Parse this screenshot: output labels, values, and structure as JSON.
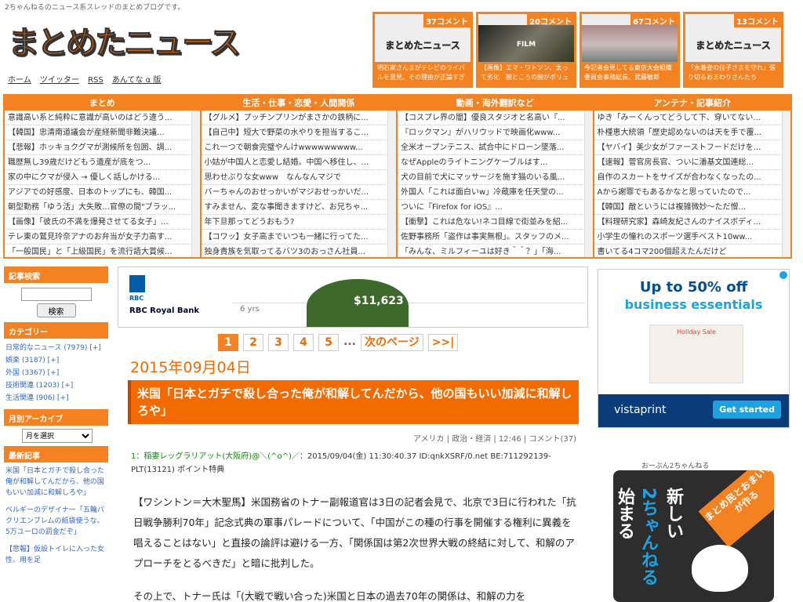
{
  "header": {
    "tagline": "2ちゃんねるのニュース系スレッドのまとめブログです。",
    "logo": "まとめたニュース",
    "nav": [
      "ホーム",
      "ツイッター",
      "RSS",
      "あんてな α 版"
    ]
  },
  "thumbs": [
    {
      "count": "37コメント",
      "image_text": "まとめたニュース",
      "caption": "明石家さんまがテレビのライバルを意見、その理由が正論すぎ"
    },
    {
      "count": "20コメント",
      "image_text": "FILM",
      "caption": "【画像】エマ・ワトソン、太って劣化　腕ところの腕がボリュー"
    },
    {
      "count": "67コメント",
      "image_text": "",
      "caption": "今記者会見してる東京大会組織委員会事務総長、武藤敏郎"
    },
    {
      "count": "13コメント",
      "image_text": "まとめたニュース",
      "caption": "「水着姿の佳子さまを守れ」張り切るおまわりさんたち"
    }
  ],
  "grid": [
    {
      "title": "まとめ",
      "items": [
        "意識高い系と純粋に意識が高いのはどう違う...",
        "【韓国】忠清南道議会が産経新聞非難決議...",
        "【悲報】ホッキョクグマが測候所を包囲、調...",
        "職歴無し39歳だけどもう遺産が底をつ...",
        "家の中にクマが侵入 → 優しく話しかける...",
        "アジアでの好感度、日本のトップにも、韓国...",
        "朝型勤務「ゆう活」大失敗…官僚の間\"ブラッ...",
        "【画像】「彼氏の不満を爆発させてる女子」...",
        "テレ東の鷲見玲奈アナのお弁当が女子力高す...",
        "「一般国民」と「上級国民」を流行語大賞候..."
      ]
    },
    {
      "title": "生活・仕事・恋愛・人間関係",
      "items": [
        "【グルメ】プッチンプリンがまさかの鉄柄に...",
        "【自己中】短大で野菜の水やりを担当するこ...",
        "これ一つで朝食完璧やんけwwwwwwwww...",
        "小姑が中国人と恋愛し結婚。中国へ移住し、...",
        "思わせぶりな女www　なんなんマジで",
        "バーちゃんのおせっかいがマジおせっかいだ...",
        "すみません、変な事聞きますけど、お兄ちゃ...",
        "年下旦那ってどうおもう?",
        "【コワッ】女子高までいつも一緒に行ってた...",
        "独身貴族を気取ってるバツ3のおっさん社員..."
      ]
    },
    {
      "title": "動画・海外翻訳など",
      "items": [
        "【コスプレ界の闇】優良スタジオと名高い『...",
        "『ロックマン』がハリウッドで映画化www...",
        "全米オープンテニス、試合中にドローン墜落...",
        "なぜAppleのライトニングケーブルはす...",
        "犬の目前で犬にマッサージを施す猫のいる風...",
        "外国人「これは面白いw」冷蔵庫を任天堂の...",
        "ついに『Firefox for iOS』...",
        "【衝撃】これは危ない!ネコ目線で街並みを紹...",
        "佐野事務所「盗作は事実無根」。スタッフのメ...",
        "「みんな、ミルフィーユは好き＾＾？」「海..."
      ]
    },
    {
      "title": "アンテナ・記事紹介",
      "items": [
        "ゆき「みーくんってどうして下、穿いてない...",
        "朴槿恵大統領「歴史認めないのは天を手で覆...",
        "【ヤバイ】美少女がファーストフードだけを...",
        "【速報】菅官房長官、ついに潘基文国連総...",
        "自作のスカートをサイズが合わなくなったの...",
        "Aから謝罪でもあるかなと思っていたので...",
        "【韓国】敵というには複雑微妙〜ただ憎...",
        "【料理研究家】森崎友紀さんのナイスボディ...",
        "小学生の憧れのスポーツ選手ベスト10ww...",
        "書いてる4コマ200個超えたんだけど"
      ]
    }
  ],
  "left": {
    "search_head": "記事検索",
    "search_btn": "検索",
    "cat_head": "カテゴリー",
    "categories": [
      "日常的なニュース (7979) [+]",
      "娯楽 (3187) [+]",
      "外国 (3367) [+]",
      "技術関連 (1203) [+]",
      "生活関連 (906) [+]"
    ],
    "archive_head": "月別アーカイブ",
    "month_select": "月を選択",
    "recent_head": "最新記事",
    "recent": [
      "米国「日本とガチで殺し合った俺が和解してんだから、他の国もいい加減に和解しろや」",
      "ベルギーのデザイナー「五輪パクリエンブレムの紙袋使うな、5万ユーロの罰金だぞ」",
      "【悲報】仮設トイレに入った女性、用を足"
    ]
  },
  "ad1": {
    "brand": "RBC",
    "name": "RBC Royal Bank",
    "yrs": "6 yrs",
    "amount": "$11,623"
  },
  "pager": {
    "pages": [
      "1",
      "2",
      "3",
      "4",
      "5"
    ],
    "dots": "...",
    "next": "次のページ",
    "last": ">>|"
  },
  "article": {
    "date": "2015年09月04日",
    "title": "米国「日本とガチで殺し合った俺が和解してんだから、他の国もいい加減に和解しろや」",
    "meta": "アメリカ | 政治・経済 | 12:46 | コメント(37)",
    "post_num": "1：稲妻レッグラリアット(大阪府)@＼(^o^)／",
    "post_info": "：2015/09/04(金) 11:30:40.37 ID:qnkXSRF/0.net BE:711292139-PLT(13121) ポイント特典",
    "body": "【ワシントン＝大木聖馬】米国務省のトナー副報道官は3日の記者会見で、北京で3日に行われた「抗日戦争勝利70年」記念式典の軍事パレードについて、「中国がこの種の行事を開催する権利に異義を唱えることはない」と直接の論評は避ける一方、「関係国は第2次世界大戦の終結に対して、和解のアプローチをとるべきだ」と暗に批判した。",
    "body2": "その上で、トナー氏は「(大戦で戦い合った)米国と日本の過去70年の関係は、和解の力を"
  },
  "ad2": {
    "line1": "Up to 50% off",
    "line2": "business essentials",
    "card": "Holiday Sale",
    "brand": "vistaprint",
    "cta": "Get started"
  },
  "banner": {
    "label": "おーぷん2ちゃんねる",
    "ribbon": "まとめ民とおまいらが作る",
    "col1": "新しい",
    "col2": "2ちゃんねる",
    "col3": "始まる"
  },
  "colors": {
    "accent": "#f58220",
    "logo": "#f26a00",
    "link": "#3366cc"
  }
}
